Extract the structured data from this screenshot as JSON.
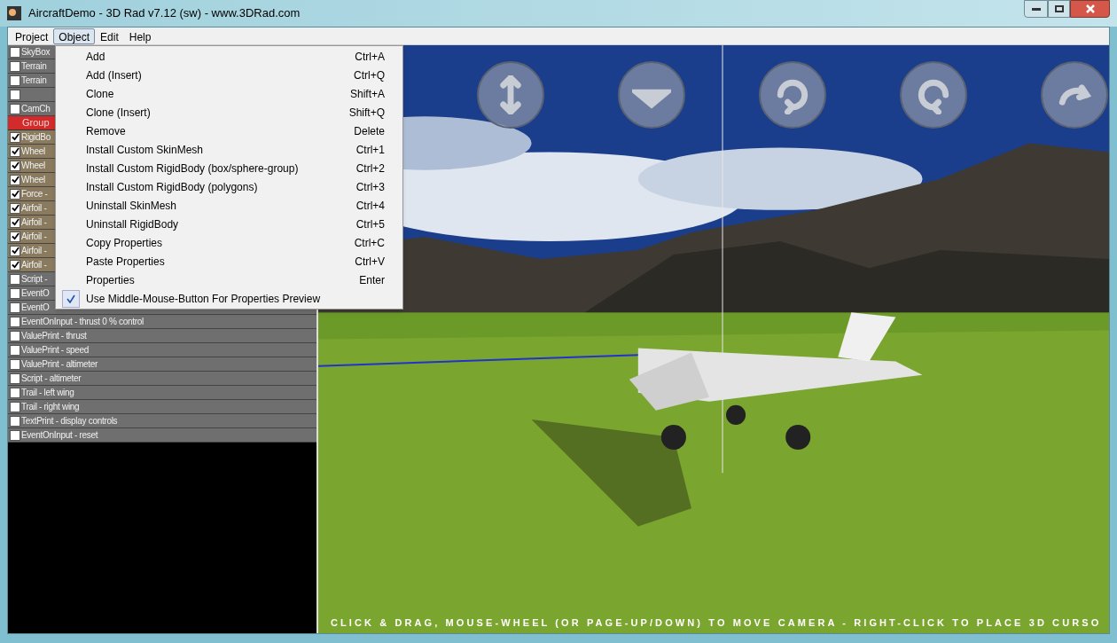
{
  "window": {
    "title": "AircraftDemo - 3D Rad v7.12 (sw) - www.3DRad.com"
  },
  "menubar": [
    {
      "label": "Project",
      "selected": false
    },
    {
      "label": "Object",
      "selected": true
    },
    {
      "label": "Edit",
      "selected": false
    },
    {
      "label": "Help",
      "selected": false
    }
  ],
  "object_menu": [
    {
      "label": "Add",
      "shortcut": "Ctrl+A"
    },
    {
      "label": "Add (Insert)",
      "shortcut": "Ctrl+Q"
    },
    {
      "label": "Clone",
      "shortcut": "Shift+A"
    },
    {
      "label": "Clone (Insert)",
      "shortcut": "Shift+Q"
    },
    {
      "label": "Remove",
      "shortcut": "Delete"
    },
    {
      "label": "Install Custom SkinMesh",
      "shortcut": "Ctrl+1"
    },
    {
      "label": "Install Custom RigidBody (box/sphere-group)",
      "shortcut": "Ctrl+2"
    },
    {
      "label": "Install Custom RigidBody (polygons)",
      "shortcut": "Ctrl+3"
    },
    {
      "label": "Uninstall SkinMesh",
      "shortcut": "Ctrl+4"
    },
    {
      "label": "Uninstall  RigidBody",
      "shortcut": "Ctrl+5"
    },
    {
      "label": "Copy Properties",
      "shortcut": "Ctrl+C"
    },
    {
      "label": "Paste Properties",
      "shortcut": "Ctrl+V"
    },
    {
      "label": "Properties",
      "shortcut": "Enter"
    },
    {
      "label": "Use Middle-Mouse-Button For Properties Preview",
      "checked": true
    }
  ],
  "objects": [
    {
      "kind": "item",
      "label": "SkyBox",
      "checked": false
    },
    {
      "kind": "item",
      "label": "Terrain",
      "checked": false
    },
    {
      "kind": "item",
      "label": "Terrain",
      "checked": false
    },
    {
      "kind": "item",
      "checked": false
    },
    {
      "kind": "item",
      "label": "CamCh",
      "checked": false
    },
    {
      "kind": "group",
      "label": "Group"
    },
    {
      "kind": "item",
      "label": "RigidBo",
      "checked": true
    },
    {
      "kind": "item",
      "label": "Wheel",
      "checked": true
    },
    {
      "kind": "item",
      "label": "Wheel",
      "checked": true
    },
    {
      "kind": "item",
      "label": "Wheel",
      "checked": true
    },
    {
      "kind": "item",
      "label": "Force -",
      "checked": true
    },
    {
      "kind": "item",
      "label": "Airfoil -",
      "checked": true
    },
    {
      "kind": "item",
      "label": "Airfoil -",
      "checked": true
    },
    {
      "kind": "item",
      "label": "Airfoil -",
      "checked": true
    },
    {
      "kind": "item",
      "label": "Airfoil -",
      "checked": true
    },
    {
      "kind": "item",
      "label": "Airfoil -",
      "checked": true
    },
    {
      "kind": "item",
      "label": "Script -",
      "checked": false
    },
    {
      "kind": "item",
      "label": "EventO",
      "checked": false
    },
    {
      "kind": "item",
      "label": "EventO",
      "checked": false
    },
    {
      "kind": "item",
      "label": "EventOnInput - thrust 0 % control",
      "checked": false
    },
    {
      "kind": "item",
      "label": "ValuePrint - thrust",
      "checked": false
    },
    {
      "kind": "item",
      "label": "ValuePrint - speed",
      "checked": false
    },
    {
      "kind": "item",
      "label": "ValuePrint - altimeter",
      "checked": false
    },
    {
      "kind": "item",
      "label": "Script - altimeter",
      "checked": false
    },
    {
      "kind": "item",
      "label": "Trail - left wing",
      "checked": false
    },
    {
      "kind": "item",
      "label": "Trail - right wing",
      "checked": false
    },
    {
      "kind": "item",
      "label": "TextPrint - display controls",
      "checked": false
    },
    {
      "kind": "item",
      "label": "EventOnInput - reset",
      "checked": false
    }
  ],
  "viewport": {
    "hint": "CLICK & DRAG, MOUSE-WHEEL (OR PAGE-UP/DOWN) TO MOVE CAMERA - RIGHT-CLICK TO PLACE 3D CURSO"
  }
}
